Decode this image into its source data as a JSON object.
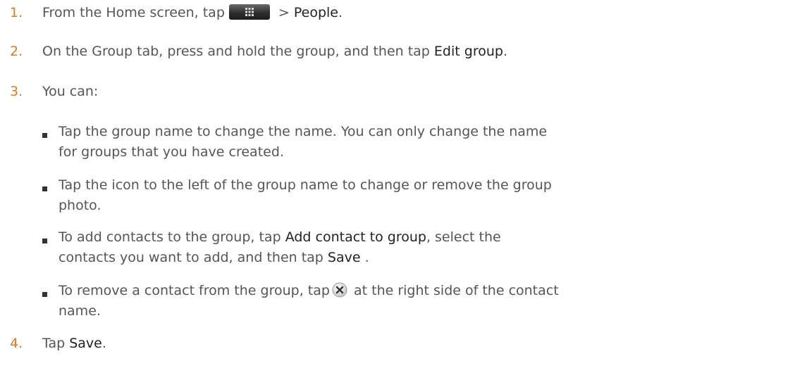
{
  "steps": [
    {
      "number": "1.",
      "text_before": "From the Home screen, tap",
      "text_after": "> ",
      "strong": "People",
      "end": "."
    },
    {
      "number": "2.",
      "text_before": "On the Group tab, press and hold the group, and then tap ",
      "strong": "Edit group",
      "end": "."
    },
    {
      "number": "3.",
      "text": "You can:"
    },
    {
      "number": "4.",
      "text_before": "Tap ",
      "strong": "Save",
      "end": "."
    }
  ],
  "bullets": [
    {
      "line1": "Tap the group name to change the name. You can only change the name",
      "line2": "for groups that you have created."
    },
    {
      "line1": "Tap the icon to the left of the group name to change or remove the group",
      "line2": "photo."
    },
    {
      "line1_before": "To add contacts to the group, tap ",
      "line1_strong": "Add contact to group",
      "line1_after": ", select the",
      "line2_before": "contacts you want to add, and then tap ",
      "line2_strong": "Save",
      "line2_after": "."
    },
    {
      "line1_before": "To remove a contact from the group, tap",
      "line1_after": "at the right side of the contact",
      "line2": "name."
    }
  ],
  "icons": {
    "apps": "all-apps-icon",
    "remove": "remove-icon"
  },
  "colors": {
    "step_number": "#e07a1b",
    "body_text": "#555555",
    "strong_text": "#222222"
  }
}
